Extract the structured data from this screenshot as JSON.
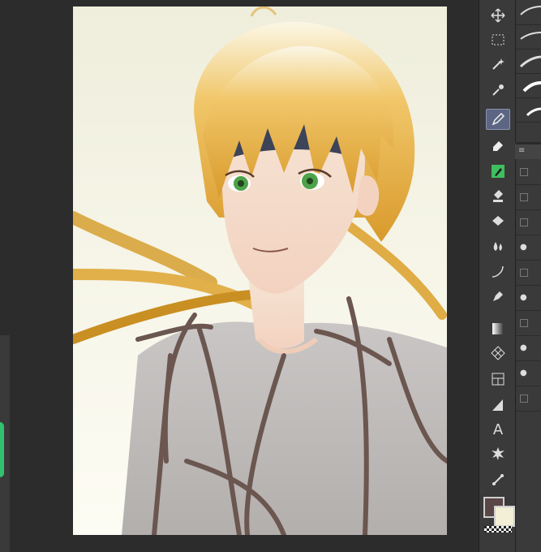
{
  "app": {
    "canvas_content": "illustration",
    "accent_active_tool": "#5c6684"
  },
  "tools": [
    {
      "name": "move-icon"
    },
    {
      "name": "selection-marquee-icon"
    },
    {
      "name": "auto-select-wand-icon"
    },
    {
      "name": "eyedropper-icon"
    },
    {
      "name": "pen-icon"
    },
    {
      "name": "eraser-icon"
    },
    {
      "name": "decoration-icon"
    },
    {
      "name": "fill-bucket-icon"
    },
    {
      "name": "blend-drop-icon"
    },
    {
      "name": "curve-line-icon"
    },
    {
      "name": "ink-pen-icon"
    },
    {
      "name": "gradient-icon"
    },
    {
      "name": "pattern-grid-icon"
    },
    {
      "name": "frame-border-icon"
    },
    {
      "name": "ruler-icon"
    },
    {
      "name": "text-icon"
    },
    {
      "name": "balloon-burst-icon"
    },
    {
      "name": "correct-line-icon"
    }
  ],
  "toolbar": {
    "text_tool_glyph": "A"
  },
  "colors": {
    "foreground": "#5a4646",
    "background": "#f2efd6"
  },
  "layers": {
    "visible_flags": [
      false,
      false,
      true,
      false,
      true,
      false,
      true,
      true,
      false
    ]
  }
}
